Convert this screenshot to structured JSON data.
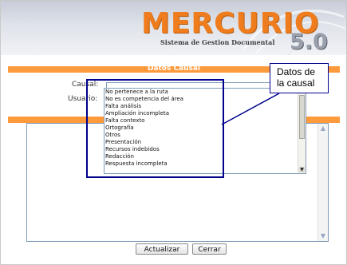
{
  "header": {
    "logo_text": "MERCURIO",
    "logo_subtitle": "Sistema de Gestion Documental",
    "logo_version": "5.0"
  },
  "causal_section": {
    "title": "Datos Causal",
    "causal_label": "Causal:",
    "usuario_label": "Usuario:",
    "options": [
      "No pertenece a la ruta",
      "No es competencia del área",
      "Falta análisis",
      "Ampliación incompleta",
      "Falta contexto",
      "Ortografía",
      "Otros",
      "Presentación",
      "Recursos indebidos",
      "Redacción",
      "Respuesta incompleta"
    ]
  },
  "annotation": {
    "callout_text_line1": "Datos de",
    "callout_text_line2": "la causal"
  },
  "buttons": {
    "update_label": "Actualizar",
    "close_label": "Cerrar"
  },
  "colors": {
    "brand_orange": "#ef7d1e",
    "section_bar": "#ff9a3c",
    "annotation_blue": "#00008b"
  }
}
